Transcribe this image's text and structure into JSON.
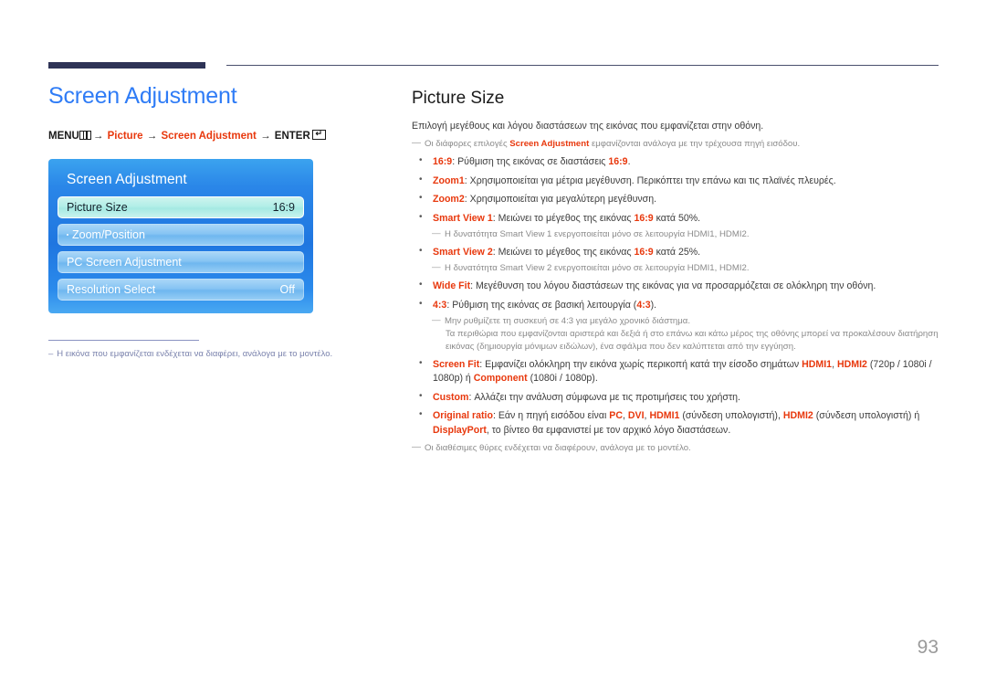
{
  "page": {
    "number": "93"
  },
  "left": {
    "section_title": "Screen Adjustment",
    "breadcrumb": {
      "menu_label": "MENU",
      "arrow": "→",
      "item1": "Picture",
      "item2": "Screen Adjustment",
      "enter_label": "ENTER",
      "enter_glyph": "↵"
    },
    "osd": {
      "title": "Screen Adjustment",
      "rows": [
        {
          "label": "Picture Size",
          "value": "16:9",
          "selected": true,
          "dot": false
        },
        {
          "label": "Zoom/Position",
          "value": "",
          "selected": false,
          "dot": true
        },
        {
          "label": "PC Screen Adjustment",
          "value": "",
          "selected": false,
          "dot": false
        },
        {
          "label": "Resolution Select",
          "value": "Off",
          "selected": false,
          "dot": false
        }
      ]
    },
    "footnote": {
      "dash": "–",
      "text": "Η εικόνα που εμφανίζεται ενδέχεται να διαφέρει, ανάλογα με το μοντέλο."
    }
  },
  "right": {
    "topic_title": "Picture Size",
    "intro": "Επιλογή μεγέθους και λόγου διαστάσεων της εικόνας που εμφανίζεται στην οθόνη.",
    "intro_note": {
      "dash": "—",
      "pre": "Οι διάφορες επιλογές ",
      "hl": "Screen Adjustment",
      "post": " εμφανίζονται ανάλογα με την τρέχουσα πηγή εισόδου."
    },
    "bullets": [
      {
        "term": "16:9",
        "sep": ": ",
        "text_pre": "Ρύθμιση της εικόνας σε διαστάσεις ",
        "inline_hl": "16:9",
        "text_post": "."
      },
      {
        "term": "Zoom1",
        "sep": ": ",
        "text_pre": "Χρησιμοποιείται για μέτρια μεγέθυνση. Περικόπτει την επάνω και τις πλαϊνές πλευρές.",
        "inline_hl": "",
        "text_post": ""
      },
      {
        "term": "Zoom2",
        "sep": ": ",
        "text_pre": "Χρησιμοποιείται για μεγαλύτερη μεγέθυνση.",
        "inline_hl": "",
        "text_post": ""
      },
      {
        "term": "Smart View 1",
        "sep": ": ",
        "text_pre": "Μειώνει το μέγεθος της εικόνας ",
        "inline_hl": "16:9",
        "text_post": " κατά 50%.",
        "subnote": {
          "dash": "—",
          "pre": "Η δυνατότητα ",
          "hl1": "Smart View 1",
          "mid": " ενεργοποιείται μόνο σε λειτουργία ",
          "hl2": "HDMI1",
          "sep2": ", ",
          "hl3": "HDMI2",
          "post": "."
        }
      },
      {
        "term": "Smart View 2",
        "sep": ": ",
        "text_pre": "Μειώνει το μέγεθος της εικόνας ",
        "inline_hl": "16:9",
        "text_post": " κατά 25%.",
        "subnote": {
          "dash": "—",
          "pre": "Η δυνατότητα ",
          "hl1": "Smart View 2",
          "mid": " ενεργοποιείται μόνο σε λειτουργία ",
          "hl2": "HDMI1",
          "sep2": ", ",
          "hl3": "HDMI2",
          "post": "."
        }
      },
      {
        "term": "Wide Fit",
        "sep": ": ",
        "text_pre": "Μεγέθυνση του λόγου διαστάσεων της εικόνας για να προσαρμόζεται σε ολόκληρη την οθόνη.",
        "inline_hl": "",
        "text_post": ""
      },
      {
        "term": "4:3",
        "sep": ": ",
        "text_pre": "Ρύθμιση της εικόνας σε βασική λειτουργία (",
        "inline_hl": "4:3",
        "text_post": ").",
        "subnote_43": {
          "dash": "—",
          "pre": "Μην ρυθμίζετε τη συσκευή σε ",
          "hl": "4:3",
          "post": " για μεγάλο χρονικό διάστημα.",
          "cont": "Τα περιθώρια που εμφανίζονται αριστερά και δεξιά ή στο επάνω και κάτω μέρος της οθόνης μπορεί να προκαλέσουν διατήρηση εικόνας (δημιουργία μόνιμων ειδώλων), ένα σφάλμα που δεν καλύπτεται από την εγγύηση."
        }
      },
      {
        "term": "Screen Fit",
        "sep": ": ",
        "sf_pre": "Εμφανίζει ολόκληρη την εικόνα χωρίς περικοπή κατά την είσοδο σημάτων ",
        "sf_hl1": "HDMI1",
        "sf_sep": ", ",
        "sf_hl2": "HDMI2",
        "sf_mid": " (720p / 1080i / 1080p) ή ",
        "sf_hl3": "Component",
        "sf_post": " (1080i / 1080p)."
      },
      {
        "term": "Custom",
        "sep": ": ",
        "text_pre": "Αλλάζει την ανάλυση σύμφωνα με τις προτιμήσεις του χρήστη.",
        "inline_hl": "",
        "text_post": ""
      },
      {
        "term": "Original ratio",
        "sep": ": ",
        "or_pre": "Εάν η πηγή εισόδου είναι ",
        "or_hl1": "PC",
        "or_s1": ", ",
        "or_hl2": "DVI",
        "or_s2": ", ",
        "or_hl3": "HDMI1",
        "or_m1": " (σύνδεση υπολογιστή), ",
        "or_hl4": "HDMI2",
        "or_m2": " (σύνδεση υπολογιστή) ή ",
        "or_hl5": "DisplayPort",
        "or_post": ", το βίντεο θα εμφανιστεί με τον αρχικό λόγο διαστάσεων."
      }
    ],
    "final_note": {
      "dash": "—",
      "text": "Οι διαθέσιμες θύρες ενδέχεται να διαφέρουν, ανάλογα με το μοντέλο."
    }
  },
  "colors": {
    "heading_blue": "#2f7cf6",
    "highlight_red": "#e8380d",
    "rule_navy": "#2e3356",
    "body_gray": "#3c3c3c",
    "note_gray": "#8a8a8a"
  }
}
